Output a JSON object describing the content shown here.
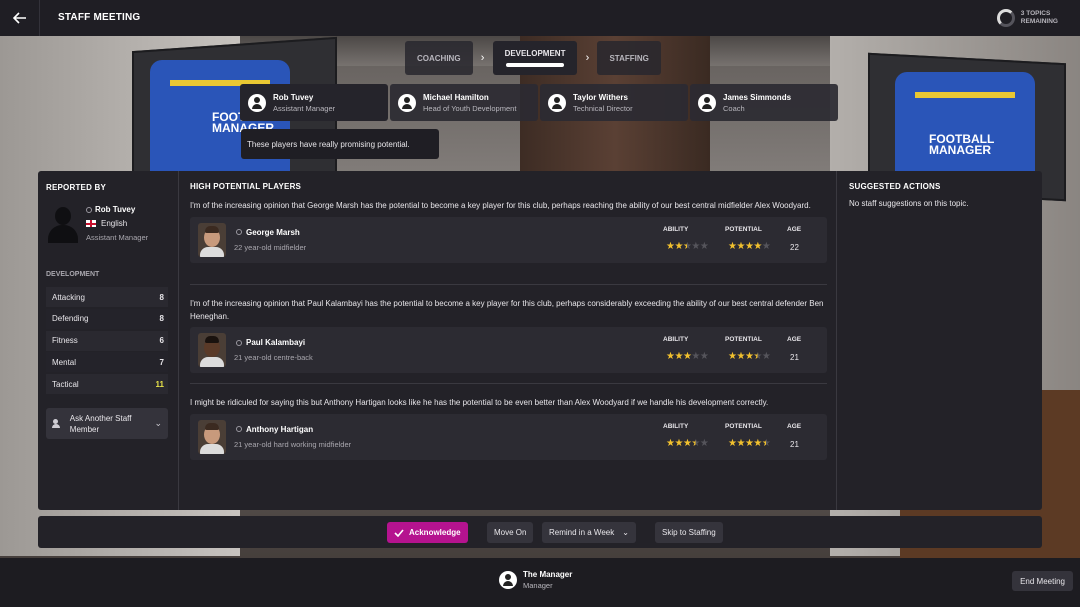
{
  "header": {
    "title": "STAFF MEETING",
    "topics_line1": "3 TOPICS",
    "topics_line2": "REMAINING"
  },
  "tabs": [
    {
      "label": "COACHING",
      "active": false
    },
    {
      "label": "DEVELOPMENT",
      "active": true
    },
    {
      "label": "STAFFING",
      "active": false
    }
  ],
  "staff": [
    {
      "name": "Rob Tuvey",
      "role": "Assistant Manager"
    },
    {
      "name": "Michael Hamilton",
      "role": "Head of Youth Development"
    },
    {
      "name": "Taylor Withers",
      "role": "Technical Director"
    },
    {
      "name": "James Simmonds",
      "role": "Coach"
    }
  ],
  "speech": "These players have really promising potential.",
  "reported_by": {
    "heading": "REPORTED BY",
    "name": "Rob Tuvey",
    "nationality": "English",
    "role": "Assistant Manager"
  },
  "development": {
    "heading": "DEVELOPMENT",
    "attributes": [
      {
        "label": "Attacking",
        "value": "8"
      },
      {
        "label": "Defending",
        "value": "8"
      },
      {
        "label": "Fitness",
        "value": "6"
      },
      {
        "label": "Mental",
        "value": "7"
      },
      {
        "label": "Tactical",
        "value": "11"
      }
    ],
    "ask_button": "Ask Another Staff Member"
  },
  "high_potential": {
    "heading": "HIGH POTENTIAL PLAYERS",
    "labels": {
      "ability": "ABILITY",
      "potential": "POTENTIAL",
      "age": "AGE"
    },
    "items": [
      {
        "text": "I'm of the increasing opinion that George Marsh has the potential to become a key player for this club, perhaps reaching the ability of our best central midfielder Alex Woodyard.",
        "name": "George Marsh",
        "desc": "22 year-old midfielder",
        "ability_stars": 2.5,
        "potential_stars": 4,
        "age": "22"
      },
      {
        "text": "I'm of the increasing opinion that Paul Kalambayi has the potential to become a key player for this club, perhaps considerably exceeding the ability of our best central defender Ben Heneghan.",
        "name": "Paul Kalambayi",
        "desc": "21 year-old centre-back",
        "ability_stars": 3,
        "potential_stars": 3.5,
        "age": "21"
      },
      {
        "text": "I might be ridiculed for saying this but Anthony Hartigan looks like he has the potential to be even better than Alex Woodyard if we handle his development correctly.",
        "name": "Anthony Hartigan",
        "desc": "21 year-old hard working midfielder",
        "ability_stars": 3.5,
        "potential_stars": 4.5,
        "age": "21"
      }
    ]
  },
  "suggested": {
    "heading": "SUGGESTED ACTIONS",
    "text": "No staff suggestions on this topic."
  },
  "actions": {
    "acknowledge": "Acknowledge",
    "move_on": "Move On",
    "remind": "Remind in a Week",
    "skip": "Skip to Staffing"
  },
  "footer": {
    "manager_name": "The Manager",
    "manager_role": "Manager",
    "end_meeting": "End Meeting"
  },
  "colors": {
    "accent": "#b5138f",
    "star": "#f2c12e",
    "highlight_value": "#e8e34a"
  }
}
